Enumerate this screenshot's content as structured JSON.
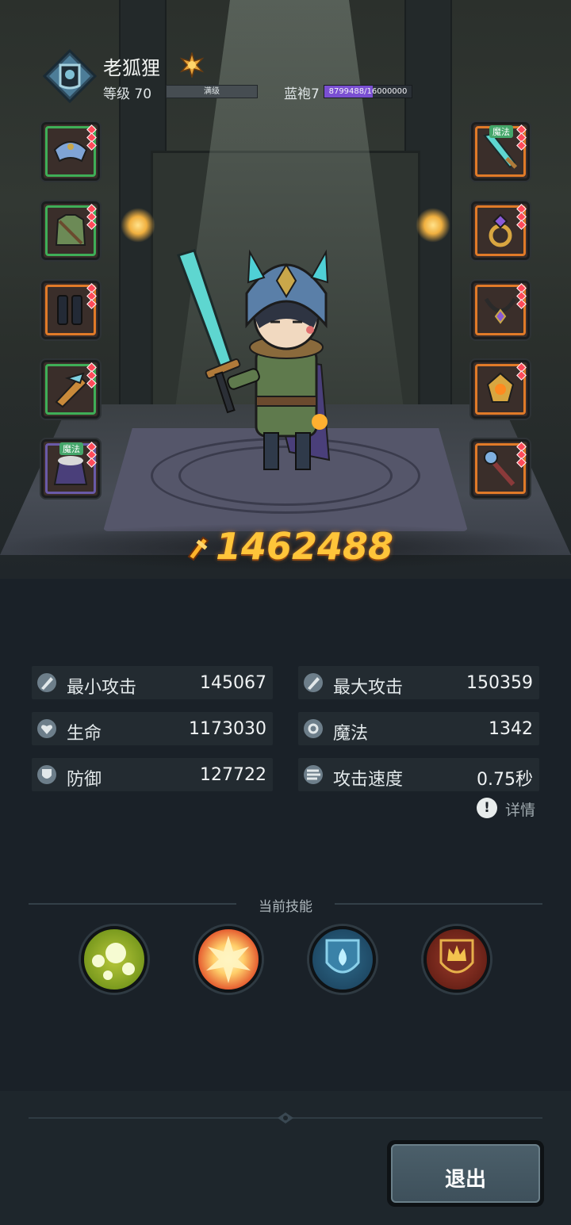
{
  "player": {
    "name": "老狐狸",
    "level_text": "等级 70",
    "level_bar_label": "满级",
    "level_progress": 1.0,
    "robe_text": "蓝袍7",
    "robe_exp": "8799488/16000000",
    "robe_progress": 0.55
  },
  "equipment": {
    "left": [
      {
        "name": "shoulder-armor",
        "rarity": "green"
      },
      {
        "name": "chest-armor",
        "rarity": "green"
      },
      {
        "name": "boots",
        "rarity": "orange"
      },
      {
        "name": "bracer",
        "rarity": "green"
      },
      {
        "name": "cape",
        "rarity": "green",
        "tag": "魔法"
      }
    ],
    "right": [
      {
        "name": "sword",
        "rarity": "orange",
        "tag": "魔法"
      },
      {
        "name": "ring",
        "rarity": "orange"
      },
      {
        "name": "necklace",
        "rarity": "orange"
      },
      {
        "name": "amulet",
        "rarity": "orange"
      },
      {
        "name": "staff",
        "rarity": "orange"
      }
    ]
  },
  "power": {
    "value": "1462488"
  },
  "stats": {
    "min_attack": {
      "label": "最小攻击",
      "value": "145067"
    },
    "max_attack": {
      "label": "最大攻击",
      "value": "150359"
    },
    "hp": {
      "label": "生命",
      "value": "1173030"
    },
    "magic": {
      "label": "魔法",
      "value": "1342"
    },
    "defense": {
      "label": "防御",
      "value": "127722"
    },
    "attack_speed": {
      "label": "攻击速度",
      "value": "0.75秒"
    }
  },
  "detail_label": "详情",
  "skills": {
    "title": "当前技能",
    "items": [
      "poison-orbs-skill",
      "explosion-skill",
      "water-shield-skill",
      "crown-shield-skill"
    ]
  },
  "exit_label": "退出",
  "colors": {
    "accent_gold": "#ffc53a",
    "robe_purple": "#7a4fd2",
    "bg": "#1a2128"
  }
}
